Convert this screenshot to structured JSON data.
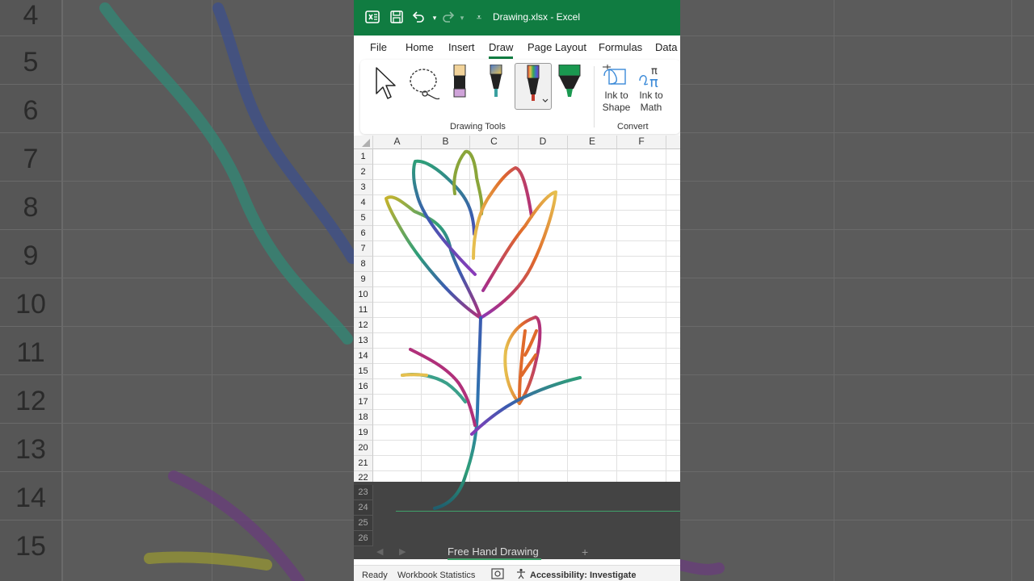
{
  "background_left": {
    "row_numbers": [
      "4",
      "5",
      "6",
      "7",
      "8",
      "9",
      "10",
      "11",
      "12",
      "13",
      "14",
      "15"
    ]
  },
  "app": {
    "title": "Drawing.xlsx  -  Excel",
    "accent": "#107c41",
    "quick_access": [
      "excel-logo-icon",
      "save-icon",
      "undo-icon",
      "redo-icon",
      "customize-icon"
    ]
  },
  "ribbon_tabs": [
    "File",
    "Home",
    "Insert",
    "Draw",
    "Page Layout",
    "Formulas",
    "Data"
  ],
  "active_tab": "Draw",
  "ribbon": {
    "drawing_tools_label": "Drawing Tools",
    "convert_label": "Convert",
    "ink_to_shape": "Ink to Shape",
    "ink_to_math": "Ink to Math"
  },
  "grid": {
    "columns": [
      "A",
      "B",
      "C",
      "D",
      "E",
      "F"
    ],
    "rows": [
      "1",
      "2",
      "3",
      "4",
      "5",
      "6",
      "7",
      "8",
      "9",
      "10",
      "11",
      "12",
      "13",
      "14",
      "15",
      "16",
      "17",
      "18",
      "19",
      "20",
      "21",
      "22",
      "23",
      "24",
      "25",
      "26"
    ]
  },
  "sheet_tab": "Free Hand Drawing",
  "add_sheet": "+",
  "status": {
    "ready": "Ready",
    "workbook_statistics": "Workbook Statistics",
    "accessibility": "Accessibility: Investigate"
  }
}
